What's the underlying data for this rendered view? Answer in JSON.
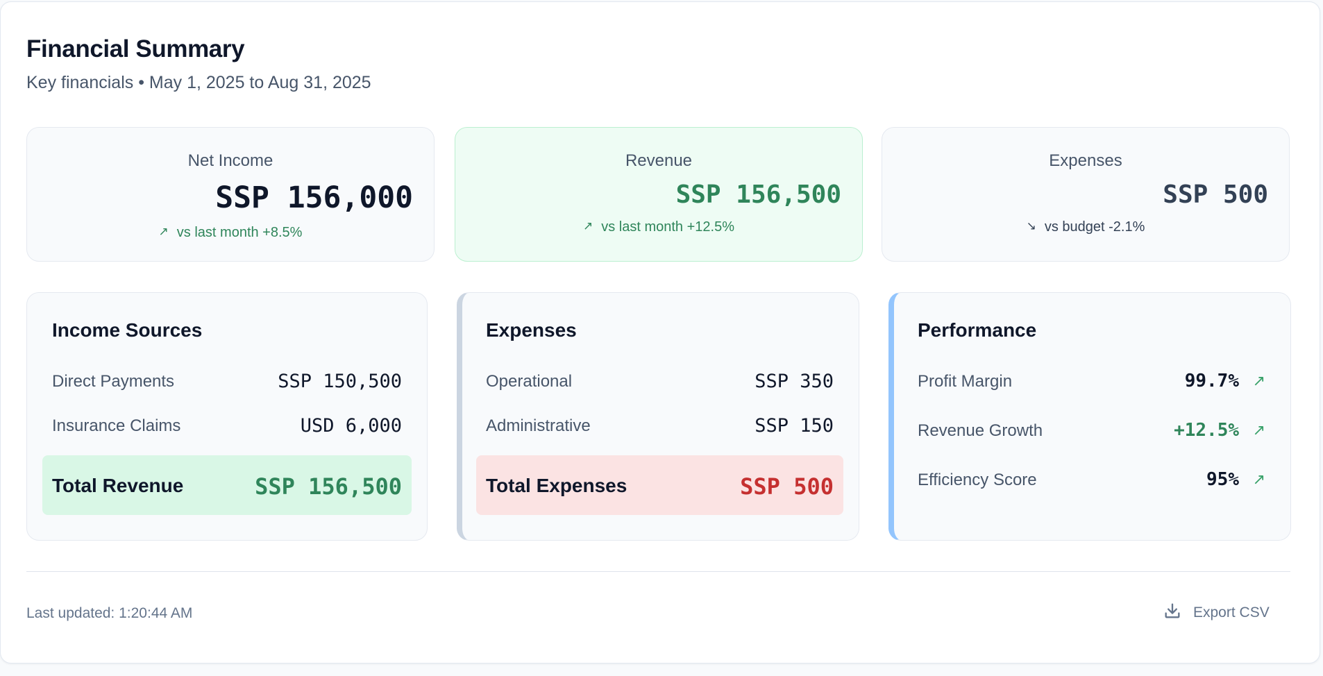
{
  "header": {
    "title": "Financial Summary",
    "subtitle": "Key financials • May 1, 2025 to Aug 31, 2025"
  },
  "kpis": [
    {
      "label": "Net Income",
      "value": "SSP 156,000",
      "trend_icon": "↗",
      "trend": "vs last month +8.5%"
    },
    {
      "label": "Revenue",
      "value": "SSP 156,500",
      "trend_icon": "↗",
      "trend": "vs last month +12.5%"
    },
    {
      "label": "Expenses",
      "value": "SSP 500",
      "trend_icon": "↘",
      "trend": "vs budget -2.1%"
    }
  ],
  "income": {
    "title": "Income Sources",
    "rows": [
      {
        "label": "Direct Payments",
        "value": "SSP 150,500"
      },
      {
        "label": "Insurance Claims",
        "value": "USD 6,000"
      }
    ],
    "total_label": "Total Revenue",
    "total_value": "SSP 156,500"
  },
  "expenses": {
    "title": "Expenses",
    "rows": [
      {
        "label": "Operational",
        "value": "SSP 350"
      },
      {
        "label": "Administrative",
        "value": "SSP 150"
      }
    ],
    "total_label": "Total Expenses",
    "total_value": "SSP 500"
  },
  "performance": {
    "title": "Performance",
    "rows": [
      {
        "label": "Profit Margin",
        "value": "99.7%",
        "arrow": "↗"
      },
      {
        "label": "Revenue Growth",
        "value": "+12.5%",
        "arrow": "↗"
      },
      {
        "label": "Efficiency Score",
        "value": "95%",
        "arrow": "↗"
      }
    ]
  },
  "footer": {
    "last_updated": "Last updated: 1:20:44 AM",
    "export_label": "Export CSV",
    "export_icon": "download-icon"
  },
  "colors": {
    "positive": "#2f855a",
    "negative": "#c53030",
    "revenue_card_bg": "#eefcf4",
    "performance_accent": "#93c5fd",
    "expenses_accent": "#cbd5e1"
  }
}
